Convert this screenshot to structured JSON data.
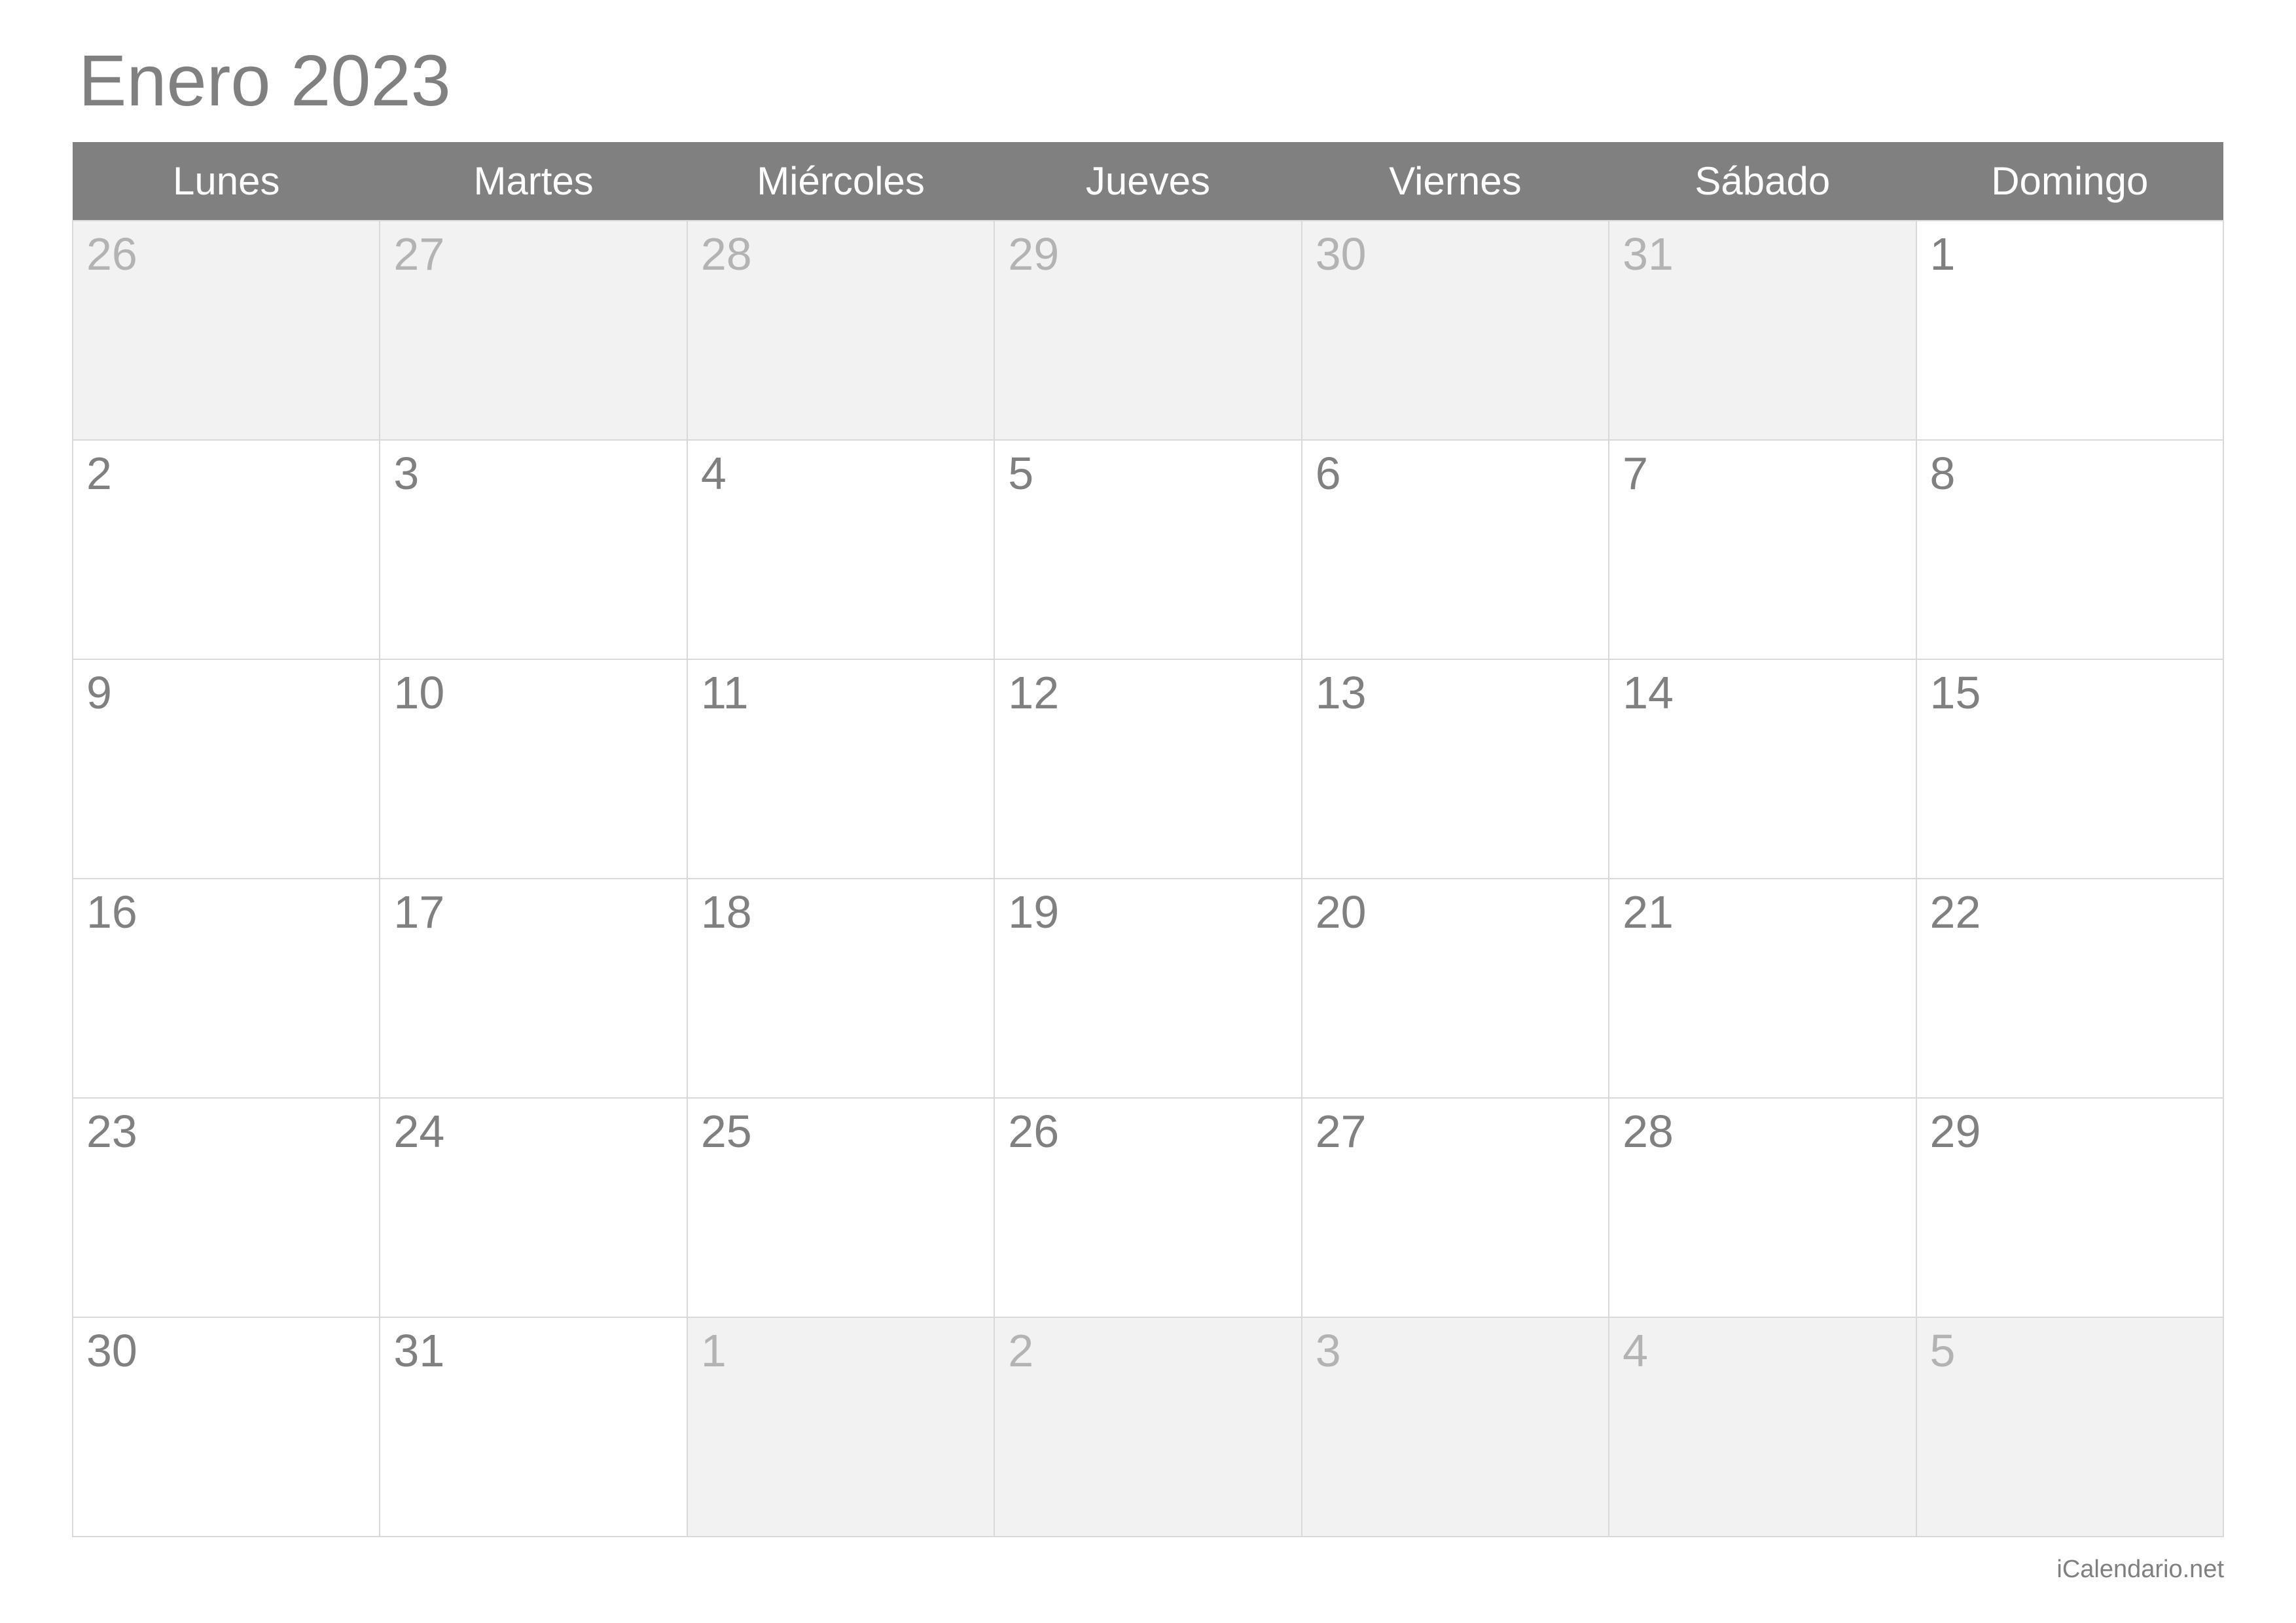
{
  "title": "Enero 2023",
  "footer": "iCalendario.net",
  "weekdays": [
    "Lunes",
    "Martes",
    "Miércoles",
    "Jueves",
    "Viernes",
    "Sábado",
    "Domingo"
  ],
  "weeks": [
    [
      {
        "day": "26",
        "other": true
      },
      {
        "day": "27",
        "other": true
      },
      {
        "day": "28",
        "other": true
      },
      {
        "day": "29",
        "other": true
      },
      {
        "day": "30",
        "other": true
      },
      {
        "day": "31",
        "other": true
      },
      {
        "day": "1",
        "other": false
      }
    ],
    [
      {
        "day": "2",
        "other": false
      },
      {
        "day": "3",
        "other": false
      },
      {
        "day": "4",
        "other": false
      },
      {
        "day": "5",
        "other": false
      },
      {
        "day": "6",
        "other": false
      },
      {
        "day": "7",
        "other": false
      },
      {
        "day": "8",
        "other": false
      }
    ],
    [
      {
        "day": "9",
        "other": false
      },
      {
        "day": "10",
        "other": false
      },
      {
        "day": "11",
        "other": false
      },
      {
        "day": "12",
        "other": false
      },
      {
        "day": "13",
        "other": false
      },
      {
        "day": "14",
        "other": false
      },
      {
        "day": "15",
        "other": false
      }
    ],
    [
      {
        "day": "16",
        "other": false
      },
      {
        "day": "17",
        "other": false
      },
      {
        "day": "18",
        "other": false
      },
      {
        "day": "19",
        "other": false
      },
      {
        "day": "20",
        "other": false
      },
      {
        "day": "21",
        "other": false
      },
      {
        "day": "22",
        "other": false
      }
    ],
    [
      {
        "day": "23",
        "other": false
      },
      {
        "day": "24",
        "other": false
      },
      {
        "day": "25",
        "other": false
      },
      {
        "day": "26",
        "other": false
      },
      {
        "day": "27",
        "other": false
      },
      {
        "day": "28",
        "other": false
      },
      {
        "day": "29",
        "other": false
      }
    ],
    [
      {
        "day": "30",
        "other": false
      },
      {
        "day": "31",
        "other": false
      },
      {
        "day": "1",
        "other": true
      },
      {
        "day": "2",
        "other": true
      },
      {
        "day": "3",
        "other": true
      },
      {
        "day": "4",
        "other": true
      },
      {
        "day": "5",
        "other": true
      }
    ]
  ]
}
